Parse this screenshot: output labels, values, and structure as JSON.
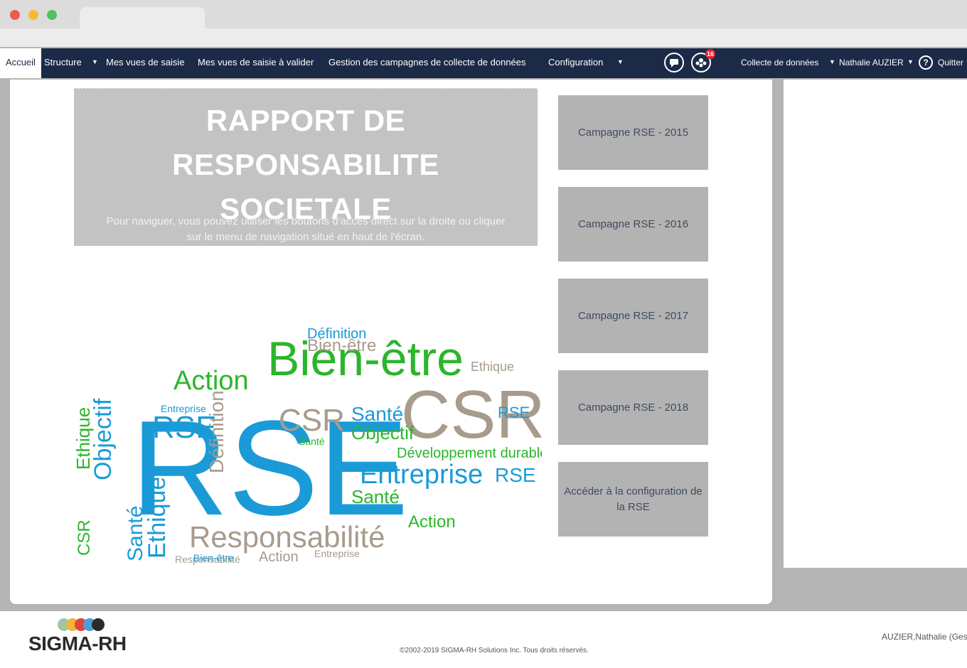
{
  "nav": {
    "accueil": "Accueil",
    "structure": "Structure",
    "mes_vues": "Mes vues de saisie",
    "vues_valider": "Mes vues de saisie à valider",
    "gestion": "Gestion des campagnes de collecte de données",
    "configuration": "Configuration",
    "badge_count": "16",
    "collecte": "Collecte de données",
    "user": "Nathalie AUZIER",
    "help": "?",
    "quitter": "Quitter"
  },
  "hero": {
    "title_line1": "RAPPORT DE RESPONSABILITE",
    "title_line2": "SOCIETALE",
    "text_line1": "Pour naviguer, vous pouvez utiliser les boutons d'accès direct sur la droite ou cliquer",
    "text_line2": "sur le menu de navigation situé en haut de l'écran."
  },
  "campaigns": [
    {
      "label": "Campagne RSE - 2015"
    },
    {
      "label": "Campagne RSE - 2016"
    },
    {
      "label": "Campagne RSE - 2017"
    },
    {
      "label": "Campagne RSE - 2018"
    },
    {
      "label": "Accéder à la configuration de la RSE"
    }
  ],
  "wordcloud": {
    "words": [
      "RSE",
      "Bien-être",
      "CSR",
      "Responsabilité",
      "Entreprise",
      "Santé",
      "Objectif",
      "Action",
      "Ethique",
      "Définition",
      "Développement durable",
      "RSE",
      "CSR",
      "Santé",
      "Objectif",
      "RSE",
      "Action",
      "Ethique",
      "Entreprise",
      "Bien-être",
      "Santé",
      "CSR",
      "Action",
      "Responsabilité",
      "Bien-être",
      "Définition",
      "Ethique",
      "RSE",
      "Entreprise",
      "Santé"
    ]
  },
  "footer": {
    "logo": "SIGMA-RH",
    "copyright": "©2002-2019 SIGMA-RH Solutions Inc. Tous droits réservés.",
    "user": "AUZIER,Nathalie (Gest"
  },
  "colors": {
    "nav_bg": "#1b2a47",
    "button_bg": "#b3b3b3",
    "cloud_blue": "#1a9bd7",
    "cloud_green": "#2bb52b",
    "cloud_taupe": "#a89b8c"
  }
}
